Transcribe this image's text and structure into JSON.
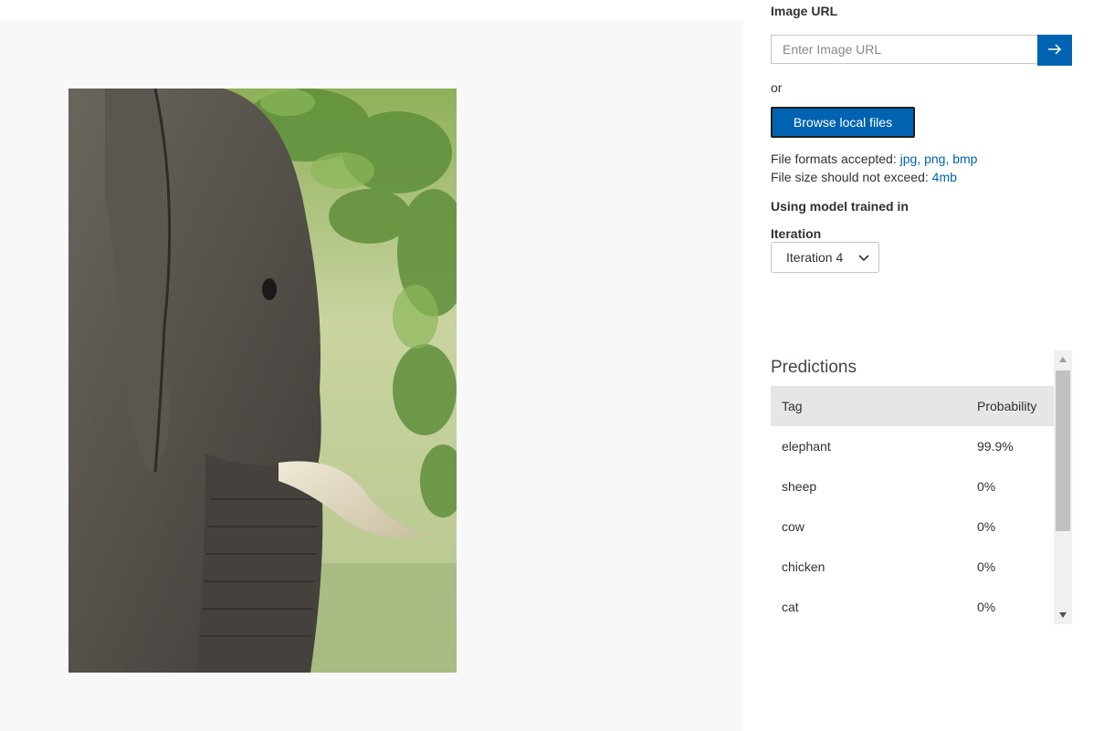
{
  "image_url": {
    "label": "Image URL",
    "placeholder": "Enter Image URL",
    "go_icon": "arrow-right-icon"
  },
  "or_text": "or",
  "browse_button": "Browse local files",
  "file_info": {
    "formats_prefix": "File formats accepted: ",
    "formats_value": "jpg, png, bmp",
    "size_prefix": "File size should not exceed: ",
    "size_value": "4mb"
  },
  "model": {
    "label": "Using model trained in",
    "iteration_label": "Iteration",
    "iteration_value": "Iteration 4"
  },
  "predictions": {
    "title": "Predictions",
    "columns": {
      "tag": "Tag",
      "probability": "Probability"
    },
    "rows": [
      {
        "tag": "elephant",
        "probability": "99.9%"
      },
      {
        "tag": "sheep",
        "probability": "0%"
      },
      {
        "tag": "cow",
        "probability": "0%"
      },
      {
        "tag": "chicken",
        "probability": "0%"
      },
      {
        "tag": "cat",
        "probability": "0%"
      }
    ]
  },
  "colors": {
    "accent": "#0063b1",
    "header_bg": "#e6e6e6",
    "preview_bg": "#f8f8f8"
  }
}
